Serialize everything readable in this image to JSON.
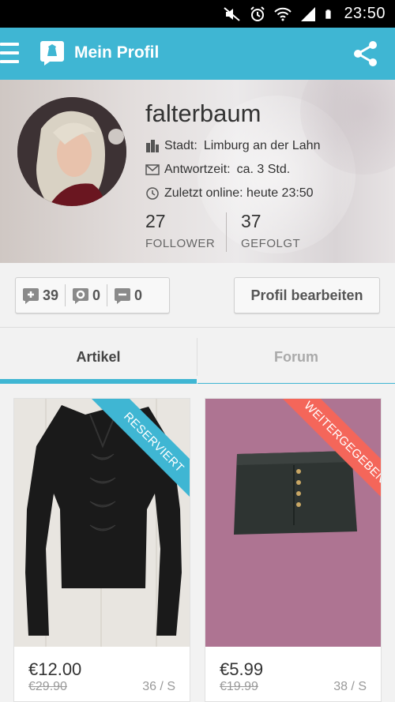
{
  "status_bar": {
    "time": "23:50"
  },
  "app_bar": {
    "title": "Mein Profil"
  },
  "profile": {
    "username": "falterbaum",
    "city_label": "Stadt:",
    "city": "Limburg an der Lahn",
    "response_label": "Antwortzeit:",
    "response": "ca. 3 Std.",
    "last_online": "Zuletzt online: heute 23:50",
    "followers": {
      "value": "27",
      "label": "FOLLOWER"
    },
    "following": {
      "value": "37",
      "label": "GEFOLGT"
    }
  },
  "toolbar": {
    "positive": "39",
    "neutral": "0",
    "negative": "0",
    "edit_label": "Profil bearbeiten"
  },
  "tabs": [
    {
      "label": "Artikel",
      "active": true
    },
    {
      "label": "Forum",
      "active": false
    }
  ],
  "items": [
    {
      "ribbon": "RESERVIERT",
      "price": "€12.00",
      "old_price": "€29.90",
      "size": "36 / S"
    },
    {
      "ribbon": "WEITERGEGEBEN",
      "price": "€5.99",
      "old_price": "€19.99",
      "size": "38 / S"
    }
  ],
  "colors": {
    "accent": "#3fb6d3",
    "reserved": "#3fb6d3",
    "given_away": "#f4665a"
  }
}
